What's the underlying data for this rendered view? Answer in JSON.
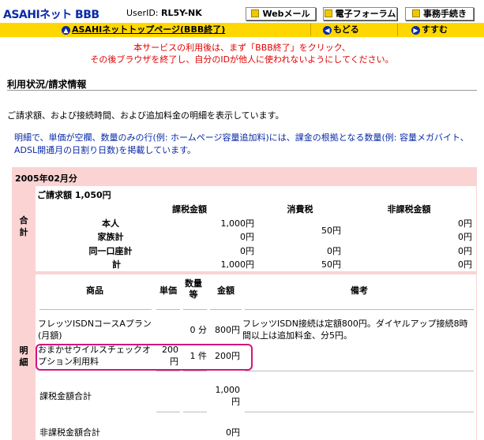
{
  "header": {
    "logo": "ASAHIネット BBB",
    "userid_label": "UserID:",
    "userid_value": "RL5Y-NK",
    "buttons": [
      "Webメール",
      "電子フォーラム",
      "事務手続き"
    ]
  },
  "nav": {
    "top_link": "ASAHIネットトップページ(BBB終了)",
    "back": "もどる",
    "next": "すすむ"
  },
  "notice": [
    "本サービスの利用後は、まず「BBB終了」をクリック、",
    "その後ブラウザを終了し、自分のIDが他人に使われないようにしてください。"
  ],
  "section_title": "利用状況/請求情報",
  "description": "ご請求額、および接続時間、および追加料金の明細を表示しています。",
  "note": "明細で、単価が空欄、数量のみの行(例: ホームページ容量追加料)には、課金の根拠となる数量(例: 容量メガバイト、ADSL開通月の日割り日数)を掲載しています。",
  "billing": {
    "month": "2005年02月分",
    "summary": {
      "side_label": "合計",
      "total": "ご請求額 1,050円",
      "headers": [
        "課税金額",
        "消費税",
        "非課税金額"
      ],
      "rows": [
        {
          "label": "本人",
          "taxable": "1,000円",
          "tax": "",
          "nontax": "0円"
        },
        {
          "label": "家族計",
          "taxable": "0円",
          "tax": "",
          "nontax": "0円"
        },
        {
          "label": "同一口座計",
          "taxable": "0円",
          "tax": "0円",
          "nontax": "0円"
        },
        {
          "label": "計",
          "taxable": "1,000円",
          "tax": "50円",
          "nontax": "0円"
        }
      ],
      "merged_tax": "50円"
    },
    "details": {
      "side_label": "明細",
      "headers": {
        "product": "商品",
        "unit_price": "単価",
        "qty": "数量等",
        "amount": "金額",
        "remarks": "備考"
      },
      "rows": [
        {
          "product": "フレッツISDNコースAプラン(月額)",
          "unit_price": "",
          "qty": "0 分",
          "amount": "800円",
          "remarks": "フレッツISDN接続は定額800円。ダイヤルアップ接続8時間以上は追加料金、分5円。"
        },
        {
          "product": "おまかせウイルスチェックオプション利用料",
          "unit_price": "200円",
          "qty": "1 件",
          "amount": "200円",
          "remarks": ""
        }
      ],
      "taxable_total_label": "課税金額合計",
      "taxable_total": "1,000円",
      "nontax_total_label": "非課税金額合計",
      "nontax_total": "0円"
    }
  },
  "colors": {
    "nav_bar": "#ffd700",
    "table_bg": "#fbd3d3",
    "notice": "#e00000",
    "note": "#0a2aa8",
    "highlight": "#d4147f"
  }
}
